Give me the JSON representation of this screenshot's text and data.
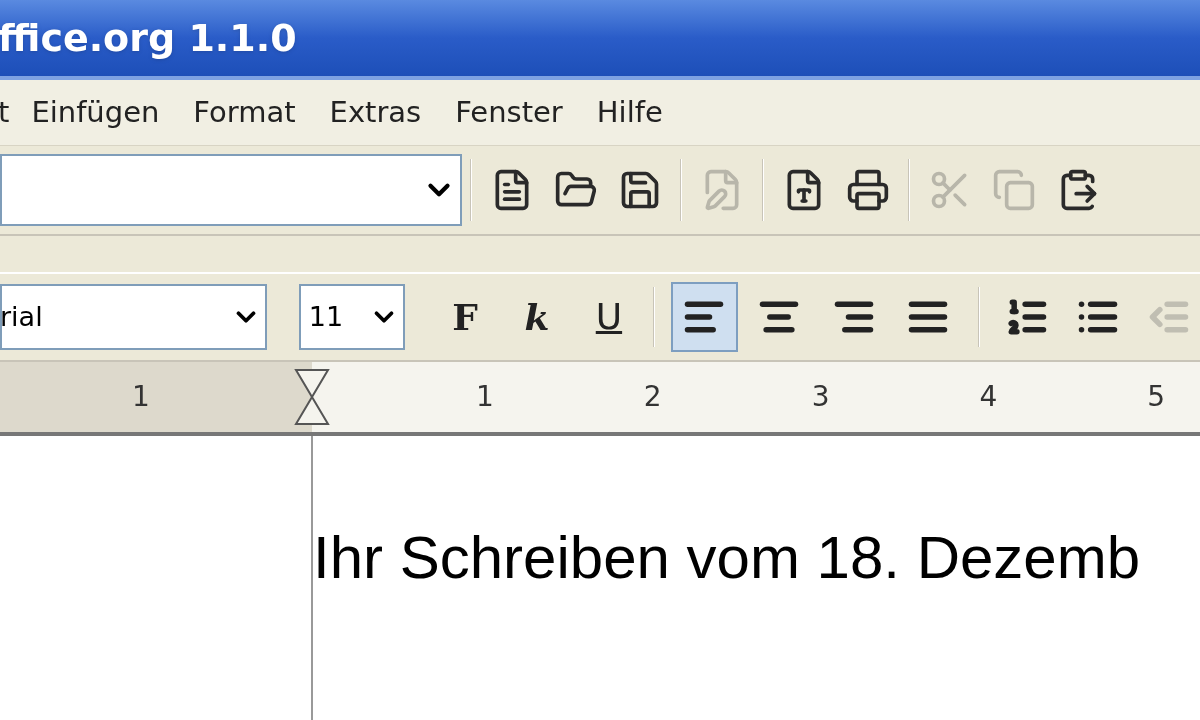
{
  "window": {
    "title": "ffice.org 1.1.0"
  },
  "menu": [
    "t",
    "Einfügen",
    "Format",
    "Extras",
    "Fenster",
    "Hilfe"
  ],
  "function_toolbar": {
    "buttons": [
      {
        "disabled": false
      },
      {
        "disabled": false
      },
      {
        "disabled": false
      },
      {
        "disabled": true
      },
      {
        "disabled": false
      },
      {
        "disabled": false
      },
      {
        "disabled": true
      },
      {
        "disabled": true
      },
      {
        "disabled": false
      }
    ]
  },
  "format_toolbar": {
    "font": "rial",
    "size": "11",
    "style_buttons": [
      {
        "label": "F"
      },
      {
        "label": "k"
      },
      {
        "label": "U"
      }
    ],
    "align_buttons": [
      {
        "selected": true
      },
      {
        "selected": false
      },
      {
        "selected": false
      },
      {
        "selected": false
      }
    ],
    "list_buttons": [
      {
        "disabled": false
      },
      {
        "disabled": false
      },
      {
        "disabled": true
      }
    ]
  },
  "ruler": {
    "left_labels": [
      "1"
    ],
    "labels": [
      "1",
      "2",
      "3",
      "4",
      "5"
    ]
  },
  "document": {
    "text": "Ihr Schreiben vom 18. Dezemb"
  }
}
